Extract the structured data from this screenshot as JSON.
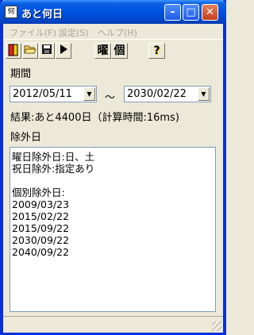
{
  "window": {
    "title": "あと何日",
    "app_icon": "何"
  },
  "menu": {
    "file": "ファイル(F)",
    "settings": "設定(S)",
    "help": "ヘルプ(H)"
  },
  "toolbar": {
    "weekday_label": "曜",
    "individual_label": "個",
    "help_label": "?"
  },
  "period": {
    "label": "期間",
    "start_date": "2012/05/11",
    "separator": "～",
    "end_date": "2030/02/22"
  },
  "result": {
    "text": "結果:あと4400日（計算時間:16ms)"
  },
  "excluded": {
    "label": "除外日",
    "lines": [
      "曜日除外日:日、土",
      "祝日除外:指定あり",
      "",
      "個別除外日:",
      "2009/03/23",
      "2015/02/22",
      "2015/09/22",
      "2030/09/22",
      "2040/09/22"
    ]
  },
  "colors": {
    "titlebar": "#0054e3",
    "window_face": "#ece9d8",
    "border": "#0831d9"
  }
}
